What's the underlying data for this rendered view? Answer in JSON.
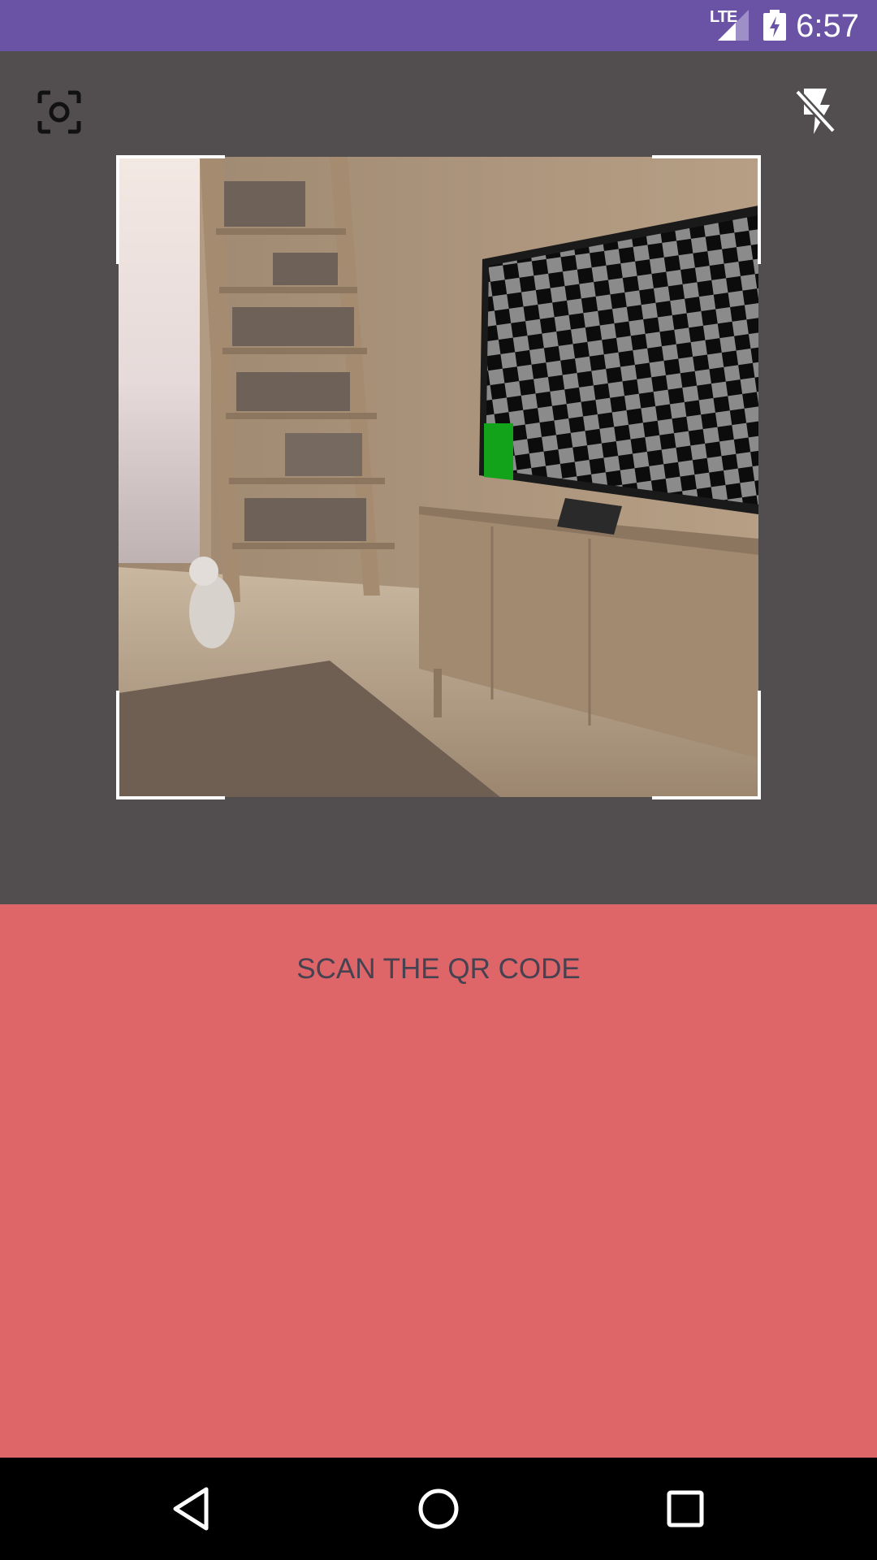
{
  "status_bar": {
    "network": "LTE",
    "time": "6:57",
    "icons": [
      "lte-signal-icon",
      "battery-charging-icon"
    ],
    "color": "#6a52a5"
  },
  "camera": {
    "left_icon": "camera-switch-icon",
    "right_icon": "flash-off-icon",
    "background": "#524e50"
  },
  "panel": {
    "instruction": "SCAN THE QR CODE",
    "background": "#df6668",
    "text_color": "#474251"
  },
  "nav_bar": {
    "buttons": [
      "back-icon",
      "home-icon",
      "recents-icon"
    ]
  }
}
